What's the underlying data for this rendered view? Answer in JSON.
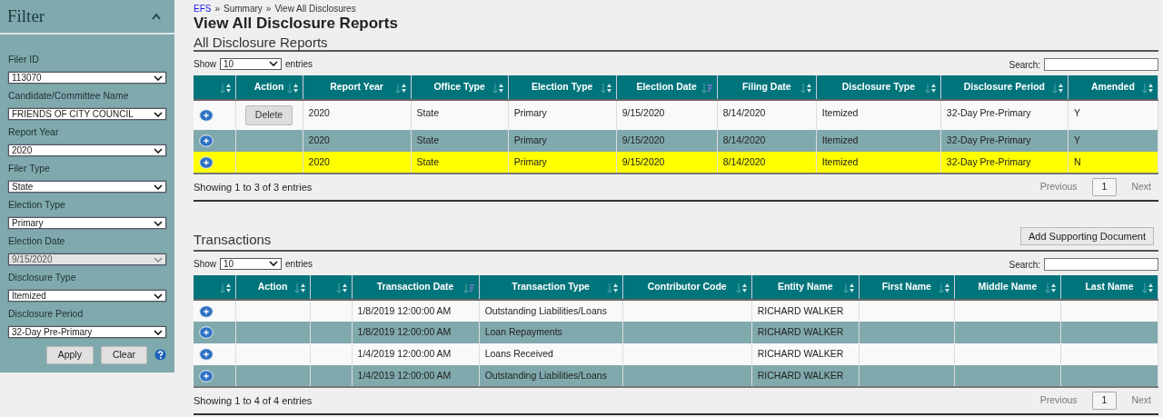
{
  "sidebar": {
    "title": "Filter",
    "filters": [
      {
        "label": "Filer ID",
        "value": "113070",
        "disabled": false
      },
      {
        "label": "Candidate/Committee Name",
        "value": "FRIENDS OF CITY COUNCIL",
        "disabled": false
      },
      {
        "label": "Report Year",
        "value": "2020",
        "disabled": false
      },
      {
        "label": "Filer Type",
        "value": "State",
        "disabled": false
      },
      {
        "label": "Election Type",
        "value": "Primary",
        "disabled": false
      },
      {
        "label": "Election Date",
        "value": "9/15/2020",
        "disabled": true
      },
      {
        "label": "Disclosure Type",
        "value": "Itemized",
        "disabled": false
      },
      {
        "label": "Disclosure Period",
        "value": "32-Day Pre-Primary",
        "disabled": false
      }
    ],
    "buttons": [
      "Apply",
      "Clear"
    ]
  },
  "breadcrumb": [
    {
      "label": "EFS",
      "kind": "link"
    },
    {
      "label": "»",
      "kind": "separator"
    },
    {
      "label": "Summary",
      "kind": "text"
    },
    {
      "label": "»",
      "kind": "separator"
    },
    {
      "label": "View All Disclosures",
      "kind": "text"
    }
  ],
  "page_title": "View All Disclosure Reports",
  "tables": [
    {
      "title": "All Disclosure Reports",
      "show_label": "Show",
      "page_length": "10",
      "entries_label": "entries",
      "search_label": "Search:",
      "columns": [
        {
          "sorted": false
        },
        {
          "label": "Action",
          "sorted": false
        },
        {
          "label": "Report Year",
          "sorted": false
        },
        {
          "label": "Office Type",
          "sorted": false
        },
        {
          "label": "Election Type",
          "sorted": false
        },
        {
          "label": "Election Date",
          "sorted": true
        },
        {
          "label": "Filing Date",
          "sorted": false
        },
        {
          "label": "Disclosure Type",
          "sorted": false
        },
        {
          "label": "Disclosure Period",
          "sorted": false
        },
        {
          "label": "Amended",
          "sorted": false
        }
      ],
      "rows": [
        {
          "highlighted": false,
          "cells": [
            "",
            "Delete",
            "2020",
            "State",
            "Primary",
            "9/15/2020",
            "8/14/2020",
            "Itemized",
            "32-Day Pre-Primary",
            "Y"
          ]
        },
        {
          "highlighted": false,
          "cells": [
            "",
            "",
            "2020",
            "State",
            "Primary",
            "9/15/2020",
            "8/14/2020",
            "Itemized",
            "32-Day Pre-Primary",
            "Y"
          ]
        },
        {
          "highlighted": true,
          "cells": [
            "",
            "",
            "2020",
            "State",
            "Primary",
            "9/15/2020",
            "8/14/2020",
            "Itemized",
            "32-Day Pre-Primary",
            "N"
          ]
        }
      ],
      "info": "Showing 1 to 3 of 3 entries",
      "pagination": {
        "previous": "Previous",
        "page": "1",
        "next": "Next"
      }
    },
    {
      "title": "Transactions",
      "button": "Add Supporting Document",
      "show_label": "Show",
      "page_length": "10",
      "entries_label": "entries",
      "search_label": "Search:",
      "columns": [
        {
          "sorted": false
        },
        {
          "label": "Action",
          "sorted": false
        },
        {
          "sorted": false
        },
        {
          "label": "Transaction Date",
          "sorted": true
        },
        {
          "label": "Transaction Type",
          "sorted": false
        },
        {
          "label": "Contributor Code",
          "sorted": false
        },
        {
          "label": "Entity Name",
          "sorted": false
        },
        {
          "label": "First Name",
          "sorted": false
        },
        {
          "label": "Middle Name",
          "sorted": false
        },
        {
          "label": "Last Name",
          "sorted": false
        }
      ],
      "rows": [
        {
          "highlighted": false,
          "cells": [
            "",
            "",
            "",
            "1/8/2019 12:00:00 AM",
            "Outstanding Liabilities/Loans",
            "",
            "RICHARD WALKER",
            "",
            "",
            ""
          ]
        },
        {
          "highlighted": false,
          "cells": [
            "",
            "",
            "",
            "1/8/2019 12:00:00 AM",
            "Loan Repayments",
            "",
            "RICHARD WALKER",
            "",
            "",
            ""
          ]
        },
        {
          "highlighted": false,
          "cells": [
            "",
            "",
            "",
            "1/4/2019 12:00:00 AM",
            "Loans Received",
            "",
            "RICHARD WALKER",
            "",
            "",
            ""
          ]
        },
        {
          "highlighted": false,
          "cells": [
            "",
            "",
            "",
            "1/4/2019 12:00:00 AM",
            "Outstanding Liabilities/Loans",
            "",
            "RICHARD WALKER",
            "",
            "",
            ""
          ]
        }
      ],
      "info": "Showing 1 to 4 of 4 entries",
      "pagination": {
        "previous": "Previous",
        "page": "1",
        "next": "Next"
      }
    }
  ]
}
